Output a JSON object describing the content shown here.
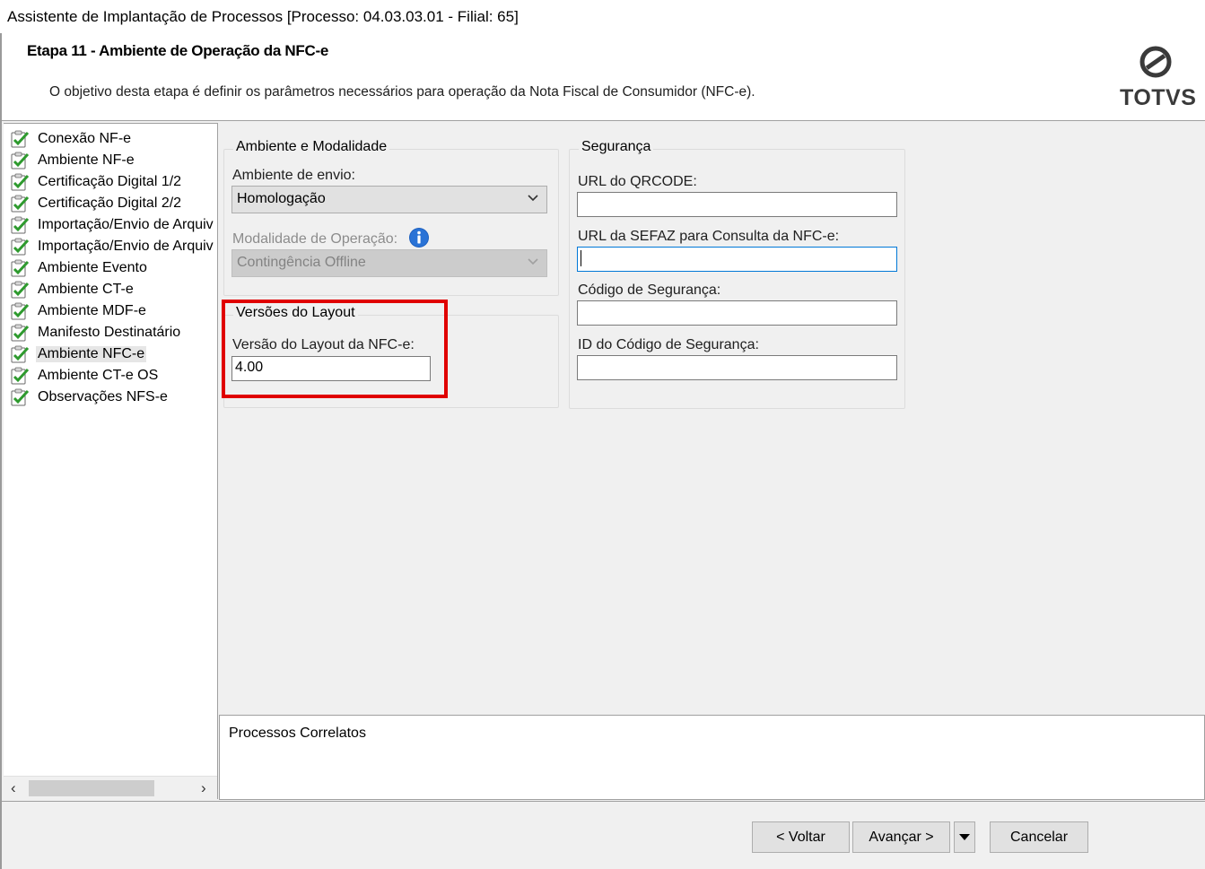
{
  "window": {
    "title": "Assistente de Implantação de Processos [Processo: 04.03.03.01 - Filial: 65]"
  },
  "header": {
    "step_title": "Etapa 11 - Ambiente de Operação da NFC-e",
    "description": "O objetivo desta etapa é definir os parâmetros necessários para operação da Nota Fiscal de Consumidor (NFC-e).",
    "logo_text": "TOTVS"
  },
  "sidebar": {
    "items": [
      {
        "label": "Conexão NF-e"
      },
      {
        "label": "Ambiente NF-e"
      },
      {
        "label": "Certificação Digital 1/2"
      },
      {
        "label": "Certificação Digital 2/2"
      },
      {
        "label": "Importação/Envio de Arquiv"
      },
      {
        "label": "Importação/Envio de Arquiv"
      },
      {
        "label": "Ambiente Evento"
      },
      {
        "label": "Ambiente CT-e"
      },
      {
        "label": "Ambiente MDF-e"
      },
      {
        "label": "Manifesto Destinatário"
      },
      {
        "label": "Ambiente NFC-e"
      },
      {
        "label": "Ambiente CT-e OS"
      },
      {
        "label": "Observações NFS-e"
      }
    ],
    "selected_label": "Ambiente NFC-e",
    "check_icon": "checklist-icon"
  },
  "ambiente_group": {
    "legend": "Ambiente e Modalidade",
    "envio_label": "Ambiente de envio:",
    "envio_value": "Homologação",
    "modalidade_label": "Modalidade de Operação:",
    "modalidade_value": "Contingência Offline",
    "info_icon": "info-icon"
  },
  "layout_group": {
    "legend": "Versões do Layout",
    "versao_label": "Versão do Layout da NFC-e:",
    "versao_value": "4.00"
  },
  "seguranca_group": {
    "legend": "Segurança",
    "qrcode_label": "URL do QRCODE:",
    "qrcode_value": "",
    "sefaz_label": "URL da SEFAZ para Consulta da NFC-e:",
    "sefaz_value": "",
    "codigo_label": "Código de Segurança:",
    "codigo_value": "",
    "id_label": "ID do Código de Segurança:",
    "id_value": ""
  },
  "related": {
    "title": "Processos Correlatos"
  },
  "footer": {
    "back_label": "< Voltar",
    "next_label": "Avançar >",
    "cancel_label": "Cancelar"
  },
  "colors": {
    "highlight_box": "#e00000",
    "focus_border": "#0078d7",
    "check_green": "#2e9a2e"
  }
}
